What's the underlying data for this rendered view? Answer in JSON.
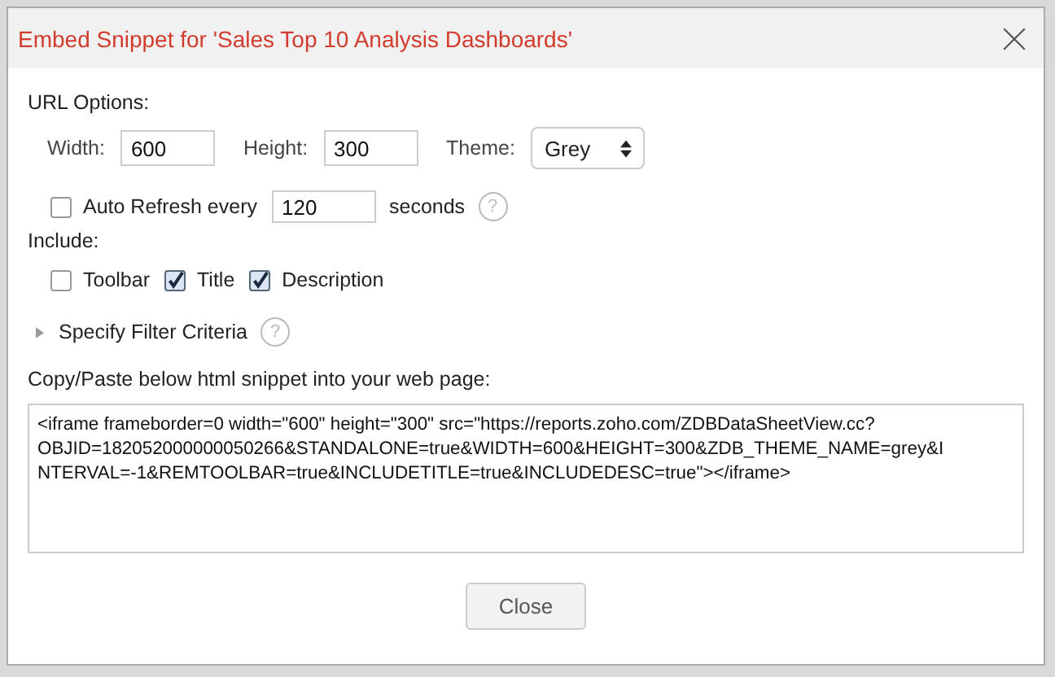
{
  "dialog": {
    "title": "Embed Snippet for 'Sales Top 10 Analysis Dashboards'"
  },
  "url_options": {
    "label": "URL Options:",
    "width": {
      "label": "Width:",
      "value": "600"
    },
    "height": {
      "label": "Height:",
      "value": "300"
    },
    "theme": {
      "label": "Theme:",
      "value": "Grey"
    }
  },
  "auto_refresh": {
    "label": "Auto Refresh every",
    "checked": false,
    "value": "120",
    "unit": "seconds",
    "help": "?"
  },
  "include": {
    "label": "Include:",
    "options": [
      {
        "label": "Toolbar",
        "checked": false
      },
      {
        "label": "Title",
        "checked": true
      },
      {
        "label": "Description",
        "checked": true
      }
    ]
  },
  "filter": {
    "label": "Specify Filter Criteria",
    "expanded": false,
    "help": "?"
  },
  "snippet": {
    "label": "Copy/Paste below html snippet into your web page:",
    "lines": [
      "<iframe frameborder=0 width=\"600\" height=\"300\" src=\"https://reports.zoho.com/ZDBDataSheetView.cc?",
      "OBJID=182052000000050266&STANDALONE=true&WIDTH=600&HEIGHT=300&ZDB_THEME_NAME=grey&I",
      "NTERVAL=-1&REMTOOLBAR=true&INCLUDETITLE=true&INCLUDEDESC=true\"></iframe>"
    ]
  },
  "buttons": [
    "Close"
  ]
}
